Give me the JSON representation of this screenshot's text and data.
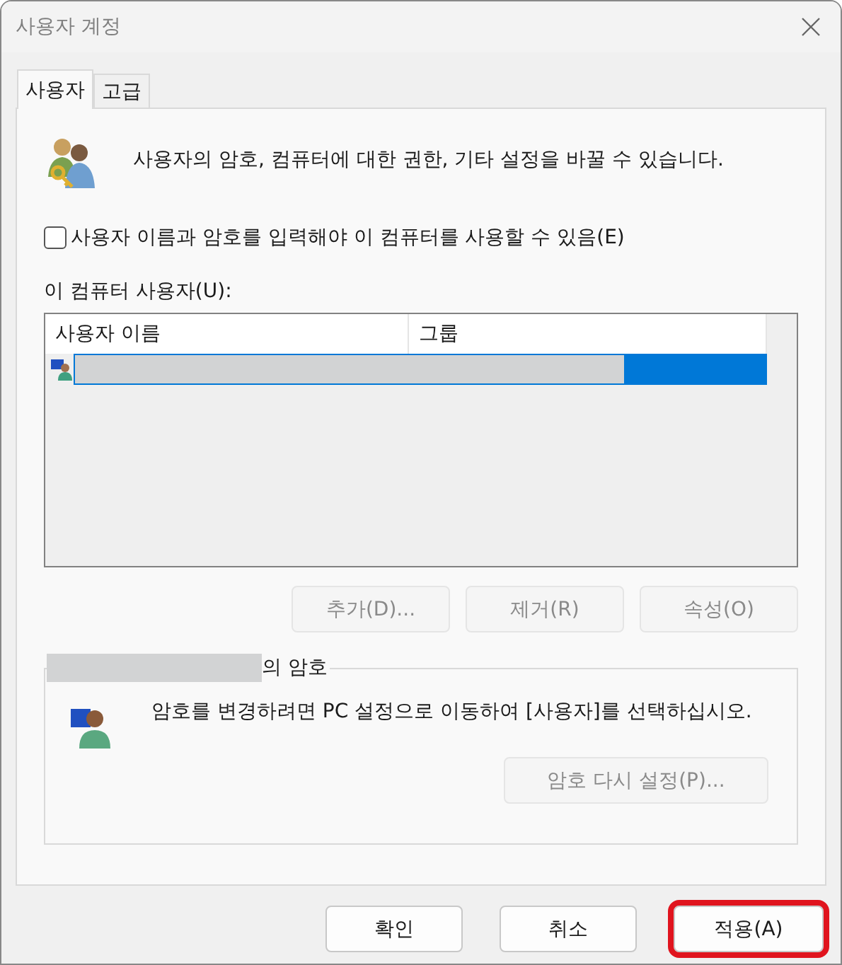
{
  "window": {
    "title": "사용자 계정"
  },
  "tabs": [
    {
      "label": "사용자",
      "selected": true
    },
    {
      "label": "고급",
      "selected": false
    }
  ],
  "intro": "사용자의 암호, 컴퓨터에 대한 권한, 기타 설정을 바꿀 수 있습니다.",
  "require_login": {
    "label": "사용자 이름과 암호를 입력해야 이 컴퓨터를 사용할 수 있음(E)",
    "checked": false
  },
  "users_label": "이 컴퓨터 사용자(U):",
  "table": {
    "columns": [
      "사용자 이름",
      "그룹"
    ],
    "rows": [
      {
        "redacted": true,
        "selected": true
      }
    ]
  },
  "list_buttons": [
    {
      "label": "추가(D)...",
      "disabled": true
    },
    {
      "label": "제거(R)",
      "disabled": true
    },
    {
      "label": "속성(O)",
      "disabled": true
    }
  ],
  "password_group": {
    "title": "의 암호",
    "title_redacted": true,
    "text": "암호를 변경하려면 PC 설정으로 이동하여 [사용자]를 선택하십시오.",
    "button": {
      "label": "암호 다시 설정(P)...",
      "disabled": true
    }
  },
  "footer_buttons": [
    {
      "label": "확인",
      "highlighted": false
    },
    {
      "label": "취소",
      "highlighted": false
    },
    {
      "label": "적용(A)",
      "highlighted": true
    }
  ]
}
